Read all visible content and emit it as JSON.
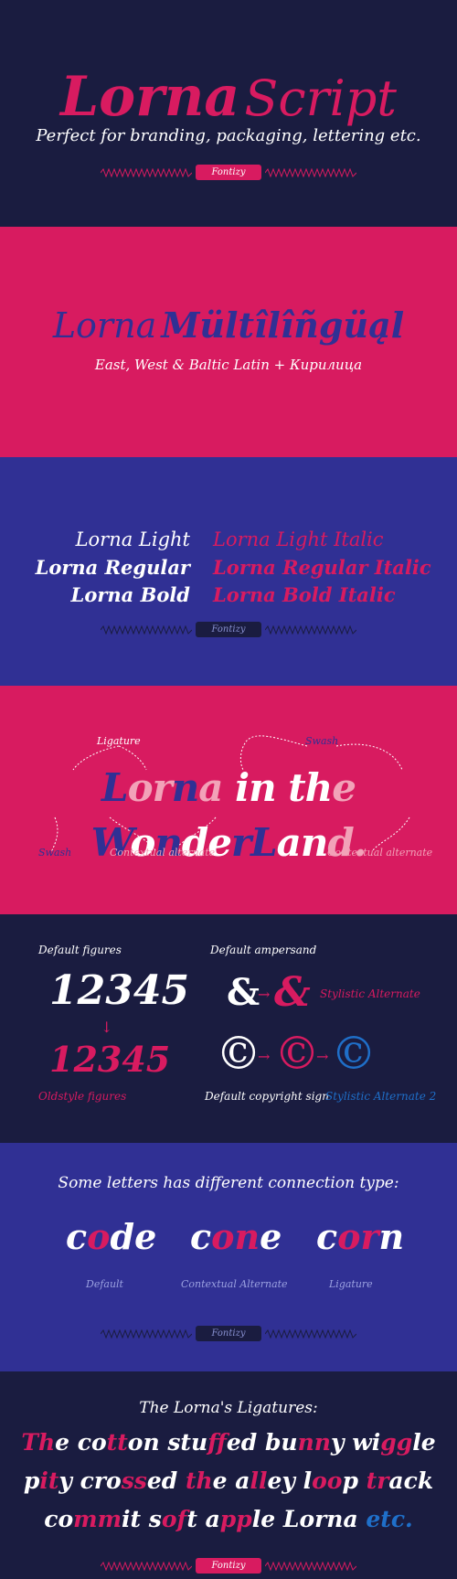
{
  "colors": {
    "navy": "#1a1c40",
    "pink": "#d81b60",
    "blue": "#303094",
    "white": "#ffffff",
    "lightpink": "#f2a2b8",
    "copyright_blue": "#1f6fc9"
  },
  "header": {
    "title_bold": "Lorna",
    "title_script": "Script",
    "tagline": "Perfect for branding, packaging, lettering etc.",
    "badge": "Fontizy"
  },
  "multilingual": {
    "title_light": "Lorna",
    "title_bold": "Mültîlîñgüąl",
    "subtitle": "East, West & Baltic Latin + Кирилица"
  },
  "weights": {
    "upright": [
      "Lorna Light",
      "Lorna Regular",
      "Lorna Bold"
    ],
    "italic": [
      "Lorna Light Italic",
      "Lorna Regular Italic",
      "Lorna Bold Italic"
    ],
    "badge": "Fontizy"
  },
  "wonderland": {
    "label_ligature": "Ligature",
    "label_swash_top": "Swash",
    "label_swash_bottom": "Swash",
    "label_contextual_1": "Contextual alternate",
    "label_contextual_2": "Contextual alternate",
    "phrase": [
      "L",
      "o",
      "r",
      "n",
      "a",
      " ",
      "i",
      "n",
      " ",
      "t",
      "h",
      "e",
      " ",
      "W",
      "o",
      "n",
      "d",
      "e",
      "r",
      "L",
      "a",
      "n",
      "d",
      "."
    ]
  },
  "figures": {
    "default_label": "Default figures",
    "default_value": "12345",
    "arrow_down": "↓",
    "oldstyle_value": "12345",
    "oldstyle_label": "Oldstyle figures",
    "ampersand_label": "Default ampersand",
    "amp_default": "&",
    "amp_alt": "&",
    "arrow_right": "→",
    "amp_alt_label": "Stylistic Alternate",
    "copy_default": "©",
    "copy_alt1": "©",
    "copy_alt2": "©",
    "copy_default_label": "Default copyright sign",
    "copy_alt_label": "Stylistic Alternate 2"
  },
  "connections": {
    "heading": "Some letters has different connection type:",
    "words": [
      {
        "parts": [
          "c",
          "o",
          "de"
        ],
        "caption": "Default"
      },
      {
        "parts": [
          "c",
          "on",
          "e"
        ],
        "caption": "Contextual Alternate"
      },
      {
        "parts": [
          "c",
          "or",
          "n"
        ],
        "caption": "Ligature"
      }
    ],
    "badge": "Fontizy"
  },
  "ligatures": {
    "heading": "The Lorna's Ligatures:",
    "line1": [
      {
        "t": "Th",
        "c": "pink"
      },
      {
        "t": "e ",
        "c": "white"
      },
      {
        "t": "co",
        "c": "white"
      },
      {
        "t": "tt",
        "c": "pink"
      },
      {
        "t": "on ",
        "c": "white"
      },
      {
        "t": "stu",
        "c": "white"
      },
      {
        "t": "ff",
        "c": "pink"
      },
      {
        "t": "ed ",
        "c": "white"
      },
      {
        "t": "bu",
        "c": "white"
      },
      {
        "t": "nn",
        "c": "pink"
      },
      {
        "t": "y ",
        "c": "white"
      },
      {
        "t": "wi",
        "c": "white"
      },
      {
        "t": "gg",
        "c": "pink"
      },
      {
        "t": "le",
        "c": "white"
      }
    ],
    "line2": [
      {
        "t": "p",
        "c": "white"
      },
      {
        "t": "it",
        "c": "pink"
      },
      {
        "t": "y ",
        "c": "white"
      },
      {
        "t": "cro",
        "c": "white"
      },
      {
        "t": "ss",
        "c": "pink"
      },
      {
        "t": "ed ",
        "c": "white"
      },
      {
        "t": "th",
        "c": "pink"
      },
      {
        "t": "e ",
        "c": "white"
      },
      {
        "t": "a",
        "c": "white"
      },
      {
        "t": "ll",
        "c": "pink"
      },
      {
        "t": "ey ",
        "c": "white"
      },
      {
        "t": "l",
        "c": "white"
      },
      {
        "t": "oo",
        "c": "pink"
      },
      {
        "t": "p ",
        "c": "white"
      },
      {
        "t": "tr",
        "c": "pink"
      },
      {
        "t": "ack",
        "c": "white"
      }
    ],
    "line3": [
      {
        "t": "co",
        "c": "white"
      },
      {
        "t": "mm",
        "c": "pink"
      },
      {
        "t": "it ",
        "c": "white"
      },
      {
        "t": "s",
        "c": "white"
      },
      {
        "t": "of",
        "c": "pink"
      },
      {
        "t": "t ",
        "c": "white"
      },
      {
        "t": "a",
        "c": "white"
      },
      {
        "t": "pp",
        "c": "pink"
      },
      {
        "t": "le ",
        "c": "white"
      },
      {
        "t": "Lorna ",
        "c": "white"
      },
      {
        "t": "etc.",
        "c": "blue"
      }
    ],
    "badge": "Fontizy"
  }
}
